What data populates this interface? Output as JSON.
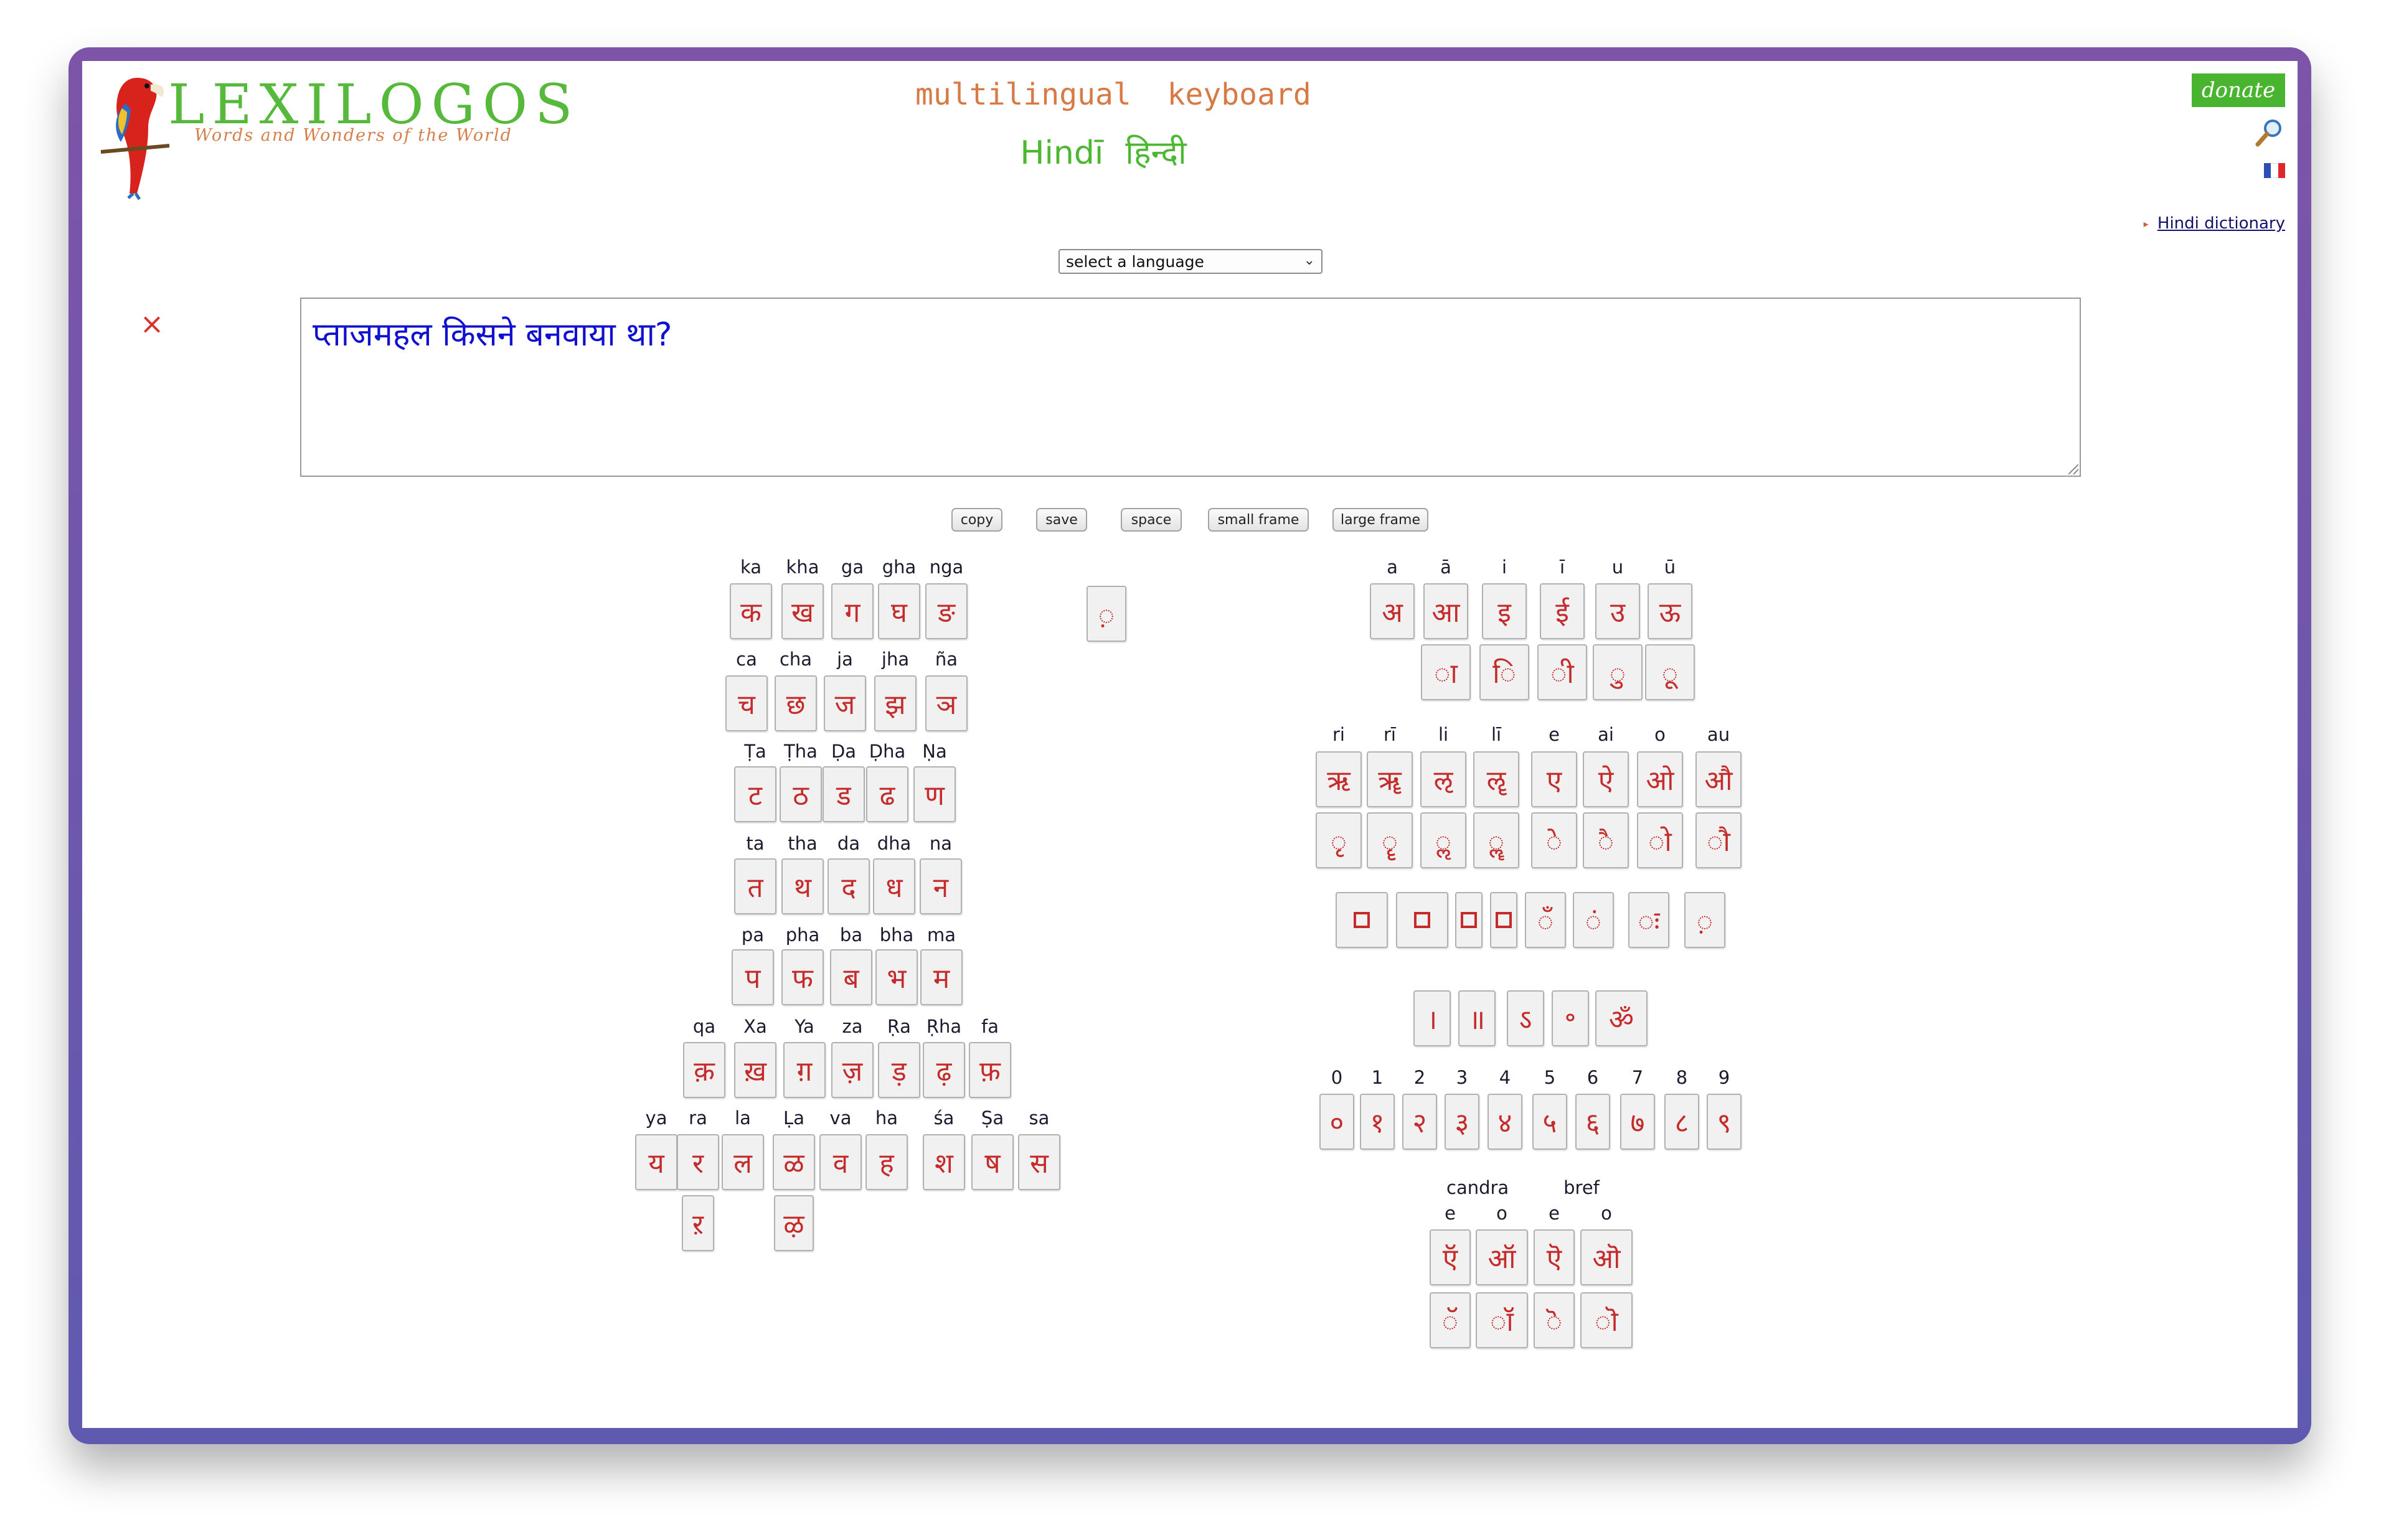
{
  "header": {
    "logo_text": "LEXILOGOS",
    "tagline": "Words and Wonders of the World",
    "title": "multilingual  keyboard",
    "language_latin": "Hindī",
    "language_native": "हिन्दी",
    "donate_label": "donate",
    "search_icon": "magnifier-icon",
    "flag_icon": "french-flag-icon",
    "dictionary_link": "Hindi dictionary"
  },
  "language_select": {
    "value": "select a language"
  },
  "clear_label": "×",
  "text_area": {
    "value": "प्ताजमहल किसने बनवाया था?"
  },
  "buttons": [
    "copy",
    "save",
    "space",
    "small frame",
    "large frame"
  ],
  "colors": {
    "frame": "#6e57ab",
    "logo_green": "#56b93b",
    "orange": "#d77a45",
    "key_text": "#c52b2b",
    "input_text": "#1010d0"
  },
  "consonants": [
    {
      "latin": [
        "ka",
        "kha",
        "ga",
        "gha",
        "nga"
      ],
      "keys": [
        "क",
        "ख",
        "ग",
        "घ",
        "ङ"
      ]
    },
    {
      "latin": [
        "ca",
        "cha",
        "ja",
        "jha",
        "ña"
      ],
      "keys": [
        "च",
        "छ",
        "ज",
        "झ",
        "ञ"
      ]
    },
    {
      "latin": [
        "Ṭa",
        "Ṭha",
        "Ḍa",
        "Ḍha",
        "Ṇa"
      ],
      "keys": [
        "ट",
        "ठ",
        "ड",
        "ढ",
        "ण"
      ]
    },
    {
      "latin": [
        "ta",
        "tha",
        "da",
        "dha",
        "na"
      ],
      "keys": [
        "त",
        "थ",
        "द",
        "ध",
        "न"
      ]
    },
    {
      "latin": [
        "pa",
        "pha",
        "ba",
        "bha",
        "ma"
      ],
      "keys": [
        "प",
        "फ",
        "ब",
        "भ",
        "म"
      ]
    },
    {
      "latin": [
        "qa",
        "Xa",
        "Ya",
        "za",
        "Ṛa",
        "Ṛha",
        "fa"
      ],
      "keys": [
        "क़",
        "ख़",
        "ग़",
        "ज़",
        "ड़",
        "ढ़",
        "फ़"
      ]
    },
    {
      "latin": [
        "ya",
        "ra",
        "la",
        "Ḷa",
        "va",
        "ha",
        "śa",
        "Ṣa",
        "sa"
      ],
      "keys": [
        "य",
        "र",
        "ल",
        "ळ",
        "व",
        "ह",
        "श",
        "ष",
        "स"
      ]
    }
  ],
  "extra_consonants": [
    "ऱ",
    "ऴ"
  ],
  "nukta_key": "◌़",
  "vowels_top": {
    "latin": [
      "a",
      "ā",
      "i",
      "ī",
      "u",
      "ū"
    ],
    "keys": [
      "अ",
      "आ",
      "इ",
      "ई",
      "उ",
      "ऊ"
    ],
    "signs": [
      "◌ा",
      "◌ि",
      "◌ी",
      "◌ु",
      "◌ू"
    ]
  },
  "vowels_mid": {
    "latin": [
      "ri",
      "rī",
      "li",
      "lī",
      "e",
      "ai",
      "o",
      "au"
    ],
    "keys": [
      "ऋ",
      "ॠ",
      "ऌ",
      "ॡ",
      "ए",
      "ऐ",
      "ओ",
      "औ"
    ],
    "signs": [
      "◌ृ",
      "◌ॄ",
      "◌ॢ",
      "◌ॣ",
      "◌े",
      "◌ै",
      "◌ो",
      "◌ौ"
    ]
  },
  "diacritics": [
    "◌ँ",
    "◌ं",
    "◌ः",
    "◌़"
  ],
  "punctuation": [
    "।",
    "॥",
    "ऽ",
    "॰",
    "ॐ"
  ],
  "digits": {
    "latin": [
      "0",
      "1",
      "2",
      "3",
      "4",
      "5",
      "6",
      "7",
      "8",
      "9"
    ],
    "keys": [
      "०",
      "१",
      "२",
      "३",
      "४",
      "५",
      "६",
      "७",
      "८",
      "९"
    ]
  },
  "candra": {
    "group_labels": [
      "candra",
      "bref"
    ],
    "latin": [
      "e",
      "o",
      "e",
      "o"
    ],
    "keys": [
      "ऍ",
      "ऑ",
      "ऎ",
      "ऒ"
    ],
    "signs": [
      "◌ॅ",
      "◌ॉ",
      "◌ॆ",
      "◌ॊ"
    ]
  }
}
